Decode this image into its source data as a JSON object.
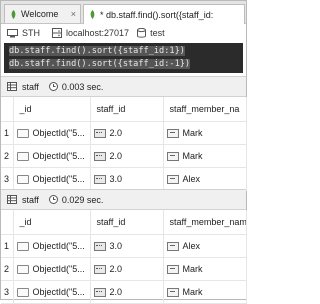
{
  "tabs": [
    {
      "label": "Welcome",
      "close": "×"
    },
    {
      "label": "* db.staff.find().sort({staff_id:",
      "close": "×"
    }
  ],
  "connection": {
    "db_label": "STH",
    "host": "localhost:27017",
    "database": "test"
  },
  "editor": {
    "lines": [
      "db.staff.find().sort({staff_id:1})",
      "db.staff.find().sort({staff_id:-1})"
    ]
  },
  "results": [
    {
      "collection": "staff",
      "time": "0.003 sec.",
      "columns": [
        "_id",
        "staff_id",
        "staff_member_na"
      ],
      "rows": [
        {
          "num": "1",
          "id": "ObjectId(\"5...",
          "staff_id": "2.0",
          "name": "Mark"
        },
        {
          "num": "2",
          "id": "ObjectId(\"5...",
          "staff_id": "2.0",
          "name": "Mark"
        },
        {
          "num": "3",
          "id": "ObjectId(\"5...",
          "staff_id": "3.0",
          "name": "Alex"
        }
      ]
    },
    {
      "collection": "staff",
      "time": "0.029 sec.",
      "columns": [
        "_id",
        "staff_id",
        "staff_member_name"
      ],
      "rows": [
        {
          "num": "1",
          "id": "ObjectId(\"5...",
          "staff_id": "3.0",
          "name": "Alex"
        },
        {
          "num": "2",
          "id": "ObjectId(\"5...",
          "staff_id": "2.0",
          "name": "Mark"
        },
        {
          "num": "3",
          "id": "ObjectId(\"5...",
          "staff_id": "2.0",
          "name": "Mark"
        }
      ]
    }
  ],
  "colors": {
    "editor_bg": "#2b2b2b",
    "editor_text": "#dcdcdc",
    "mongo_leaf": "#4a9a3a"
  }
}
